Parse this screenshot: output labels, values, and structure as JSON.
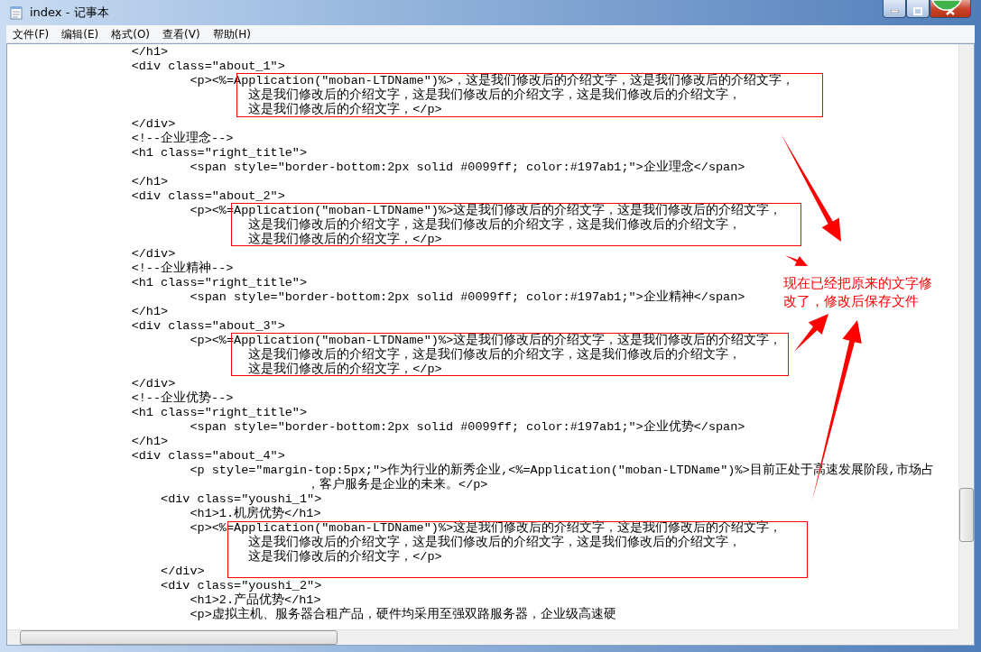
{
  "window": {
    "title": "index - 记事本"
  },
  "menu": [
    {
      "label": "文件(F)"
    },
    {
      "label": "编辑(E)"
    },
    {
      "label": "格式(O)"
    },
    {
      "label": "查看(V)"
    },
    {
      "label": "帮助(H)"
    }
  ],
  "editor": {
    "lines": [
      "\t\t</h1>",
      "\t\t<div class=\"about_1\">",
      "\t\t\t<p><%=Application(\"moban-LTDName\")%>，这是我们修改后的介绍文字，这是我们修改后的介绍文字，",
      "\t\t\t\t这是我们修改后的介绍文字，这是我们修改后的介绍文字，这是我们修改后的介绍文字，",
      "\t\t\t\t这是我们修改后的介绍文字，</p>",
      "\t\t</div>",
      "\t\t<!--企业理念-->",
      "\t\t<h1 class=\"right_title\">",
      "\t\t\t<span style=\"border-bottom:2px solid #0099ff; color:#197ab1;\">企业理念</span>",
      "\t\t</h1>",
      "\t\t<div class=\"about_2\">",
      "\t\t\t<p><%=Application(\"moban-LTDName\")%>这是我们修改后的介绍文字，这是我们修改后的介绍文字，",
      "\t\t\t\t这是我们修改后的介绍文字，这是我们修改后的介绍文字，这是我们修改后的介绍文字，",
      "\t\t\t\t这是我们修改后的介绍文字，</p>",
      "\t\t</div>",
      "\t\t<!--企业精神-->",
      "\t\t<h1 class=\"right_title\">",
      "\t\t\t<span style=\"border-bottom:2px solid #0099ff; color:#197ab1;\">企业精神</span>",
      "\t\t</h1>",
      "\t\t<div class=\"about_3\">",
      "\t\t\t<p><%=Application(\"moban-LTDName\")%>这是我们修改后的介绍文字，这是我们修改后的介绍文字，",
      "\t\t\t\t这是我们修改后的介绍文字，这是我们修改后的介绍文字，这是我们修改后的介绍文字，",
      "\t\t\t\t这是我们修改后的介绍文字，</p>",
      "\t\t</div>",
      "\t\t<!--企业优势-->",
      "\t\t<h1 class=\"right_title\">",
      "\t\t\t<span style=\"border-bottom:2px solid #0099ff; color:#197ab1;\">企业优势</span>",
      "\t\t</h1>",
      "\t\t<div class=\"about_4\">",
      "\t\t\t<p style=\"margin-top:5px;\">作为行业的新秀企业,<%=Application(\"moban-LTDName\")%>目前正处于高速发展阶段,市场占",
      "\t\t\t\t\t，客户服务是企业的未来。</p>",
      "\t\t    <div class=\"youshi_1\">",
      "\t\t\t<h1>1.机房优势</h1>",
      "\t\t\t<p><%=Application(\"moban-LTDName\")%>这是我们修改后的介绍文字，这是我们修改后的介绍文字，",
      "\t\t\t\t这是我们修改后的介绍文字，这是我们修改后的介绍文字，这是我们修改后的介绍文字，",
      "\t\t\t\t这是我们修改后的介绍文字，</p>",
      "\t\t    </div>",
      "\t\t    <div class=\"youshi_2\">",
      "\t\t\t<h1>2.产品优势</h1>",
      "\t\t\t<p>虚拟主机、服务器合租产品，硬件均采用至强双路服务器，企业级高速硬"
    ]
  },
  "annotation": {
    "text": "现在已经把原来的文字修改了，修改后保存文件"
  }
}
